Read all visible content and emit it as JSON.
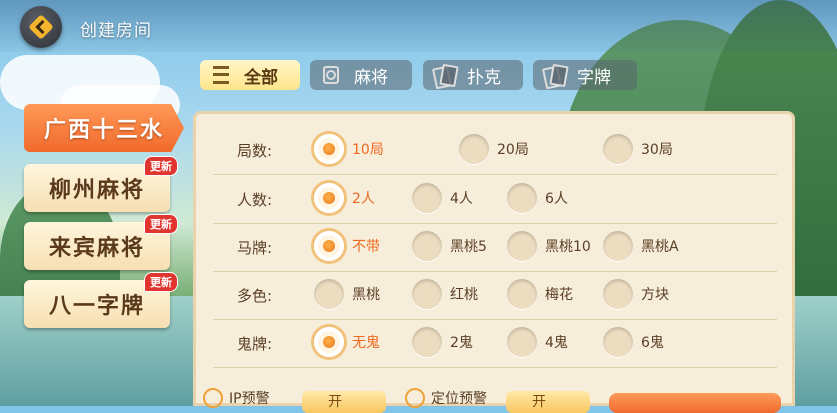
{
  "header": {
    "title": "创建房间"
  },
  "categories": [
    {
      "label": "全部",
      "icon": "list-icon",
      "active": true
    },
    {
      "label": "麻将",
      "icon": "mahjong-tile-icon",
      "active": false
    },
    {
      "label": "扑克",
      "icon": "playing-cards-icon",
      "active": false
    },
    {
      "label": "字牌",
      "icon": "word-cards-icon",
      "active": false
    }
  ],
  "games": [
    {
      "label": "广西十三水",
      "active": true,
      "badge": ""
    },
    {
      "label": "柳州麻将",
      "active": false,
      "badge": "更新"
    },
    {
      "label": "来宾麻将",
      "active": false,
      "badge": "更新"
    },
    {
      "label": "八一字牌",
      "active": false,
      "badge": "更新"
    }
  ],
  "settings": [
    {
      "label": "局数:",
      "options": [
        "10局",
        "20局",
        "30局"
      ],
      "selected": 0
    },
    {
      "label": "人数:",
      "options": [
        "2人",
        "4人",
        "6人"
      ],
      "selected": 0
    },
    {
      "label": "马牌:",
      "options": [
        "不带",
        "黑桃5",
        "黑桃10",
        "黑桃A"
      ],
      "selected": 0
    },
    {
      "label": "多色:",
      "options": [
        "黑桃",
        "红桃",
        "梅花",
        "方块"
      ],
      "selected": -1
    },
    {
      "label": "鬼牌:",
      "options": [
        "无鬼",
        "2鬼",
        "4鬼",
        "6鬼"
      ],
      "selected": 0
    }
  ],
  "bottom": {
    "ip_warning_label": "IP预警",
    "ip_warning_value": "开",
    "location_warning_label": "定位预警",
    "location_warning_value": "开"
  },
  "colors": {
    "accent": "#ec6a1f",
    "panel": "#f7eddb",
    "tab_active": "#ffe48a"
  }
}
